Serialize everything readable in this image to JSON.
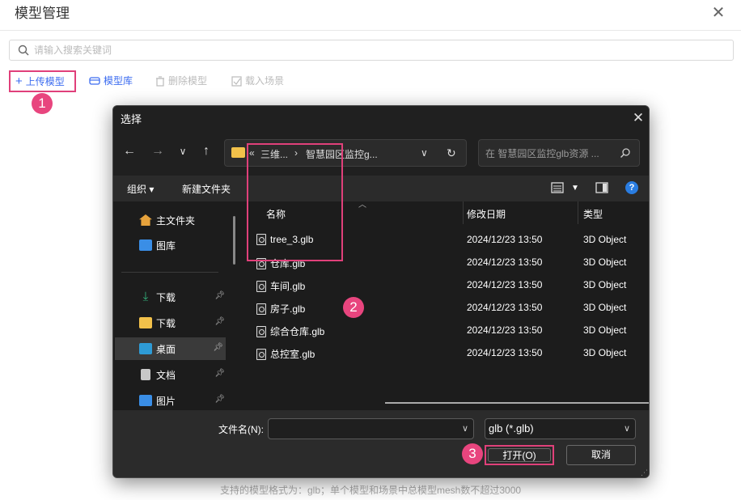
{
  "panel": {
    "title": "模型管理",
    "close_glyph": "✕",
    "search_placeholder": "请输入搜索关键词",
    "toolbar": {
      "upload_label": "上传模型",
      "library_label": "模型库",
      "delete_label": "删除模型",
      "load_label": "载入场景"
    },
    "footer_note": "支持的模型格式为：glb；单个模型和场景中总模型mesh数不超过3000"
  },
  "badges": [
    "1",
    "2",
    "3"
  ],
  "dialog": {
    "title": "选择",
    "close_glyph": "✕",
    "address": {
      "prefix": "«",
      "crumb1": "三维...",
      "separator": "›",
      "crumb2": "智慧园区监控g..."
    },
    "search_placeholder": "在 智慧园区监控glb资源 ...",
    "commands": {
      "organize": "组织 ▾",
      "new_folder": "新建文件夹"
    },
    "sidebar": {
      "items": [
        {
          "label": "主文件夹",
          "icon": "home-icon",
          "pinned": false
        },
        {
          "label": "图库",
          "icon": "gallery-icon",
          "pinned": false
        },
        {
          "label": "下载",
          "icon": "download-icon",
          "pinned": true
        },
        {
          "label": "下载",
          "icon": "folder-icon",
          "pinned": true
        },
        {
          "label": "桌面",
          "icon": "desktop-icon",
          "pinned": true,
          "selected": true
        },
        {
          "label": "文档",
          "icon": "document-icon",
          "pinned": true
        },
        {
          "label": "图片",
          "icon": "pictures-icon",
          "pinned": true
        }
      ]
    },
    "columns": {
      "name": "名称",
      "date": "修改日期",
      "type": "类型"
    },
    "files": [
      {
        "name": "tree_3.glb",
        "date": "2024/12/23 13:50",
        "type": "3D Object"
      },
      {
        "name": "仓库.glb",
        "date": "2024/12/23 13:50",
        "type": "3D Object"
      },
      {
        "name": "车间.glb",
        "date": "2024/12/23 13:50",
        "type": "3D Object"
      },
      {
        "name": "房子.glb",
        "date": "2024/12/23 13:50",
        "type": "3D Object"
      },
      {
        "name": "综合仓库.glb",
        "date": "2024/12/23 13:50",
        "type": "3D Object"
      },
      {
        "name": "总控室.glb",
        "date": "2024/12/23 13:50",
        "type": "3D Object"
      }
    ],
    "filename_label": "文件名(N):",
    "filename_value": "",
    "filetype_value": "glb (*.glb)",
    "open_label": "打开(O)",
    "cancel_label": "取消"
  },
  "colors": {
    "accent": "#3c6cf0",
    "highlight": "#e0407a",
    "badge": "#e8457e",
    "dialog_bg": "#202020"
  }
}
